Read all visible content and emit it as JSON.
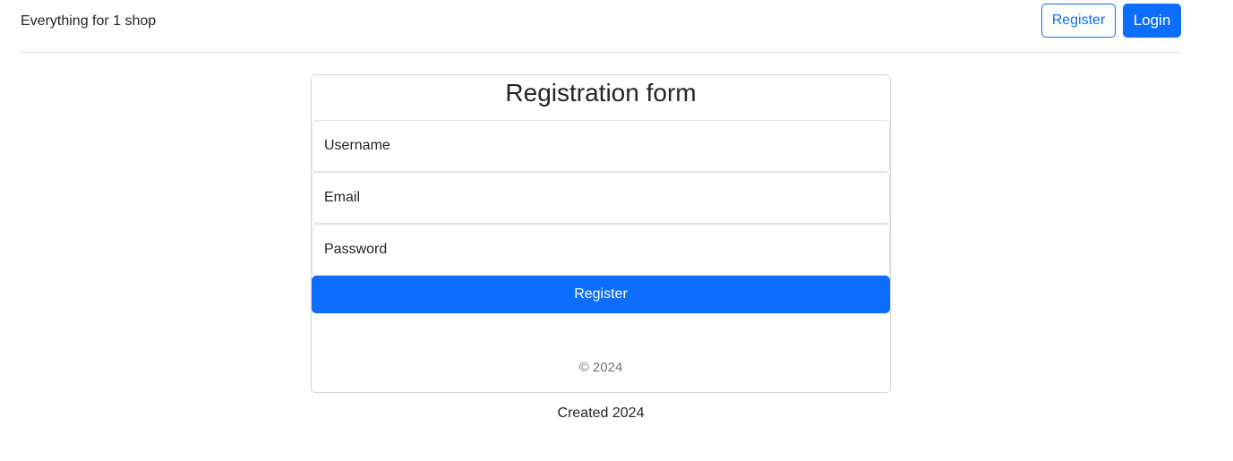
{
  "header": {
    "brand": "Everything for 1 shop",
    "register_label": "Register",
    "login_label": "Login"
  },
  "form": {
    "title": "Registration form",
    "username_placeholder": "Username",
    "email_placeholder": "Email",
    "password_placeholder": "Password",
    "submit_label": "Register",
    "copyright": "© 2024"
  },
  "footer": {
    "text": "Created 2024"
  },
  "colors": {
    "primary": "#0d6efd",
    "border": "#dee2e6",
    "muted_text": "#6c757d"
  }
}
